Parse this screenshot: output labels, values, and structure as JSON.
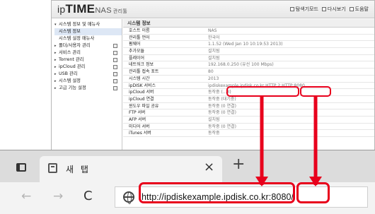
{
  "admin": {
    "logo_ip": "ip",
    "logo_time": "TIME",
    "logo_nas": "NAS",
    "logo_sub": "관리툴",
    "header_links": [
      "탐색기모드",
      "다시보기",
      "도움말"
    ],
    "sidebar": [
      {
        "label": "시스템 정보 및 매뉴사",
        "level": 1,
        "arrow": "▾"
      },
      {
        "label": "시스템 정보",
        "level": 2
      },
      {
        "label": "시스템 설정 매뉴사",
        "level": 2
      },
      {
        "label": "폴더/사용자 관리",
        "level": 1,
        "arrow": "▸",
        "mark": true
      },
      {
        "label": "서비스 관리",
        "level": 1,
        "arrow": "▸",
        "mark": true
      },
      {
        "label": "Torrent 관리",
        "level": 1,
        "arrow": "▸",
        "mark": true
      },
      {
        "label": "ipCloud 관리",
        "level": 1,
        "arrow": "▸",
        "mark": true
      },
      {
        "label": "USB 관리",
        "level": 1,
        "arrow": "▸",
        "mark": true
      },
      {
        "label": "시스템 설정",
        "level": 1,
        "arrow": "▸",
        "mark": true
      },
      {
        "label": "고급 기능 설정",
        "level": 1,
        "arrow": "▸",
        "mark": true
      }
    ],
    "main_title": "시스템 정보",
    "info_rows": [
      {
        "key": "호스트 이름",
        "value": "NAS"
      },
      {
        "key": "관리툴 언어",
        "value": "한국어"
      },
      {
        "key": "펌웨어",
        "value": "1.1.52 (Wed Jan 10 10:19:53 2013)"
      },
      {
        "key": "추가모듈",
        "value": "설치됨"
      },
      {
        "key": "플레이어",
        "value": "설치됨"
      },
      {
        "key": "네트워크 정보",
        "value": "192.168.0.250 (유선 100 Mbps)"
      },
      {
        "key": "관리툴 접속 포트",
        "value": "80"
      },
      {
        "key": "시스템 시간",
        "value": "2013"
      },
      {
        "key": "ipDISK 서비스",
        "value": "ipdiskexample.ipdisk.co.kr  HTTP 2  HTTP:8080"
      },
      {
        "key": "ipCloud 서버",
        "value": "동작중 (...3)"
      },
      {
        "key": "ipCloud 연결",
        "value": "동작중 (대기중)"
      },
      {
        "key": "윈도우 파일 공유",
        "value": "동작중 (0 연결)"
      },
      {
        "key": "FTP 서버",
        "value": "동작중 (0 연결)"
      },
      {
        "key": "AFP 서버",
        "value": "설치됨"
      },
      {
        "key": "미디어 서버",
        "value": "동작중 (0 연결)"
      },
      {
        "key": "iTunes 서버",
        "value": "동작중"
      }
    ]
  },
  "browser": {
    "tab_title": "새 탭",
    "tab_close": "×",
    "new_tab": "+",
    "back": "←",
    "forward": "→",
    "reload": "C",
    "url": "http://ipdiskexample.ipdisk.co.kr:8080/"
  },
  "callout_color": "#e8001c"
}
